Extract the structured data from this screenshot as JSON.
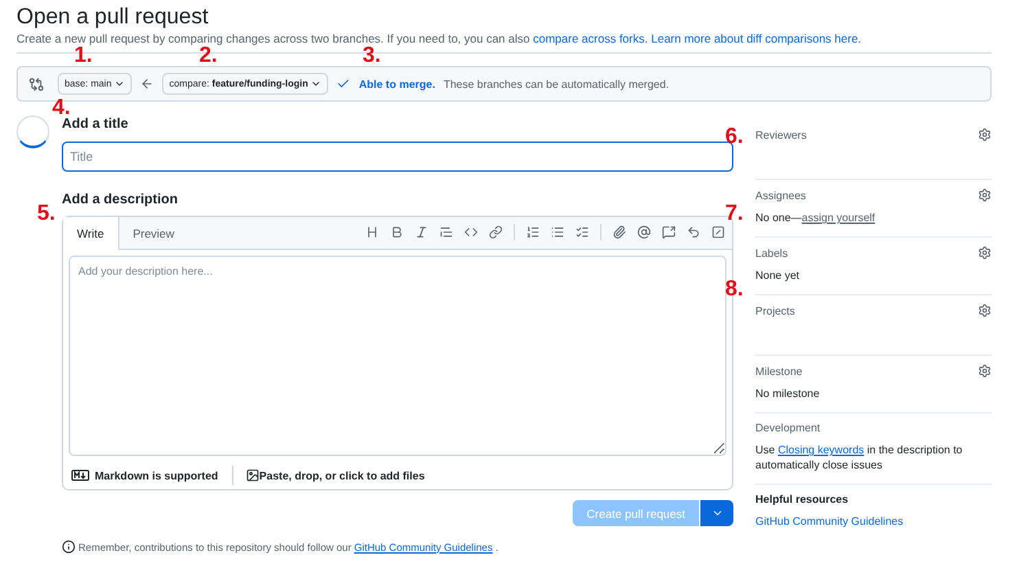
{
  "page": {
    "title": "Open a pull request",
    "intro": "Create a new pull request by comparing changes across two branches. If you need to, you can also ",
    "intro_links": [
      "compare across forks.",
      "Learn more about diff comparisons here."
    ]
  },
  "compare_bar": {
    "base": "base: main",
    "compare_prefix": "compare: ",
    "compare_branch": "feature/funding-login",
    "merge_status": "Able to merge.",
    "merge_note": "These branches can be automatically merged."
  },
  "title_section": {
    "heading": "Add a title",
    "placeholder": "Title"
  },
  "description": {
    "heading": "Add a description",
    "tabs": [
      {
        "label": "Write",
        "selected": true
      },
      {
        "label": "Preview",
        "selected": false
      }
    ],
    "placeholder": "Add your description here...",
    "footer": [
      "Markdown is supported",
      "Paste, drop, or click to add files"
    ]
  },
  "submit": {
    "label": "Create pull request",
    "disabled": true
  },
  "reminder": {
    "text": "Remember, contributions to this repository should follow our ",
    "link": "GitHub Community Guidelines",
    "end": "."
  },
  "sidebar": [
    {
      "heading": "Reviewers",
      "settings": true
    },
    {
      "heading": "Assignees",
      "settings": true,
      "text": "No one—",
      "link": "assign yourself"
    },
    {
      "heading": "Labels",
      "settings": true,
      "text": "None yet"
    },
    {
      "heading": "Projects",
      "settings": true
    },
    {
      "heading": "Milestone",
      "settings": true,
      "text": "No milestone"
    },
    {
      "heading": "Development",
      "settings": false,
      "text": "Use ",
      "link": "Closing keywords",
      "after": " in the description to automatically close issues"
    },
    {
      "heading": "Helpful resources",
      "settings": false,
      "bold": true,
      "link": "GitHub Community Guidelines"
    }
  ],
  "annotations": [
    {
      "label": "1."
    },
    {
      "label": "2."
    },
    {
      "label": "3."
    },
    {
      "label": "4."
    },
    {
      "label": "5."
    },
    {
      "label": "6."
    },
    {
      "label": "7."
    },
    {
      "label": "8."
    }
  ]
}
